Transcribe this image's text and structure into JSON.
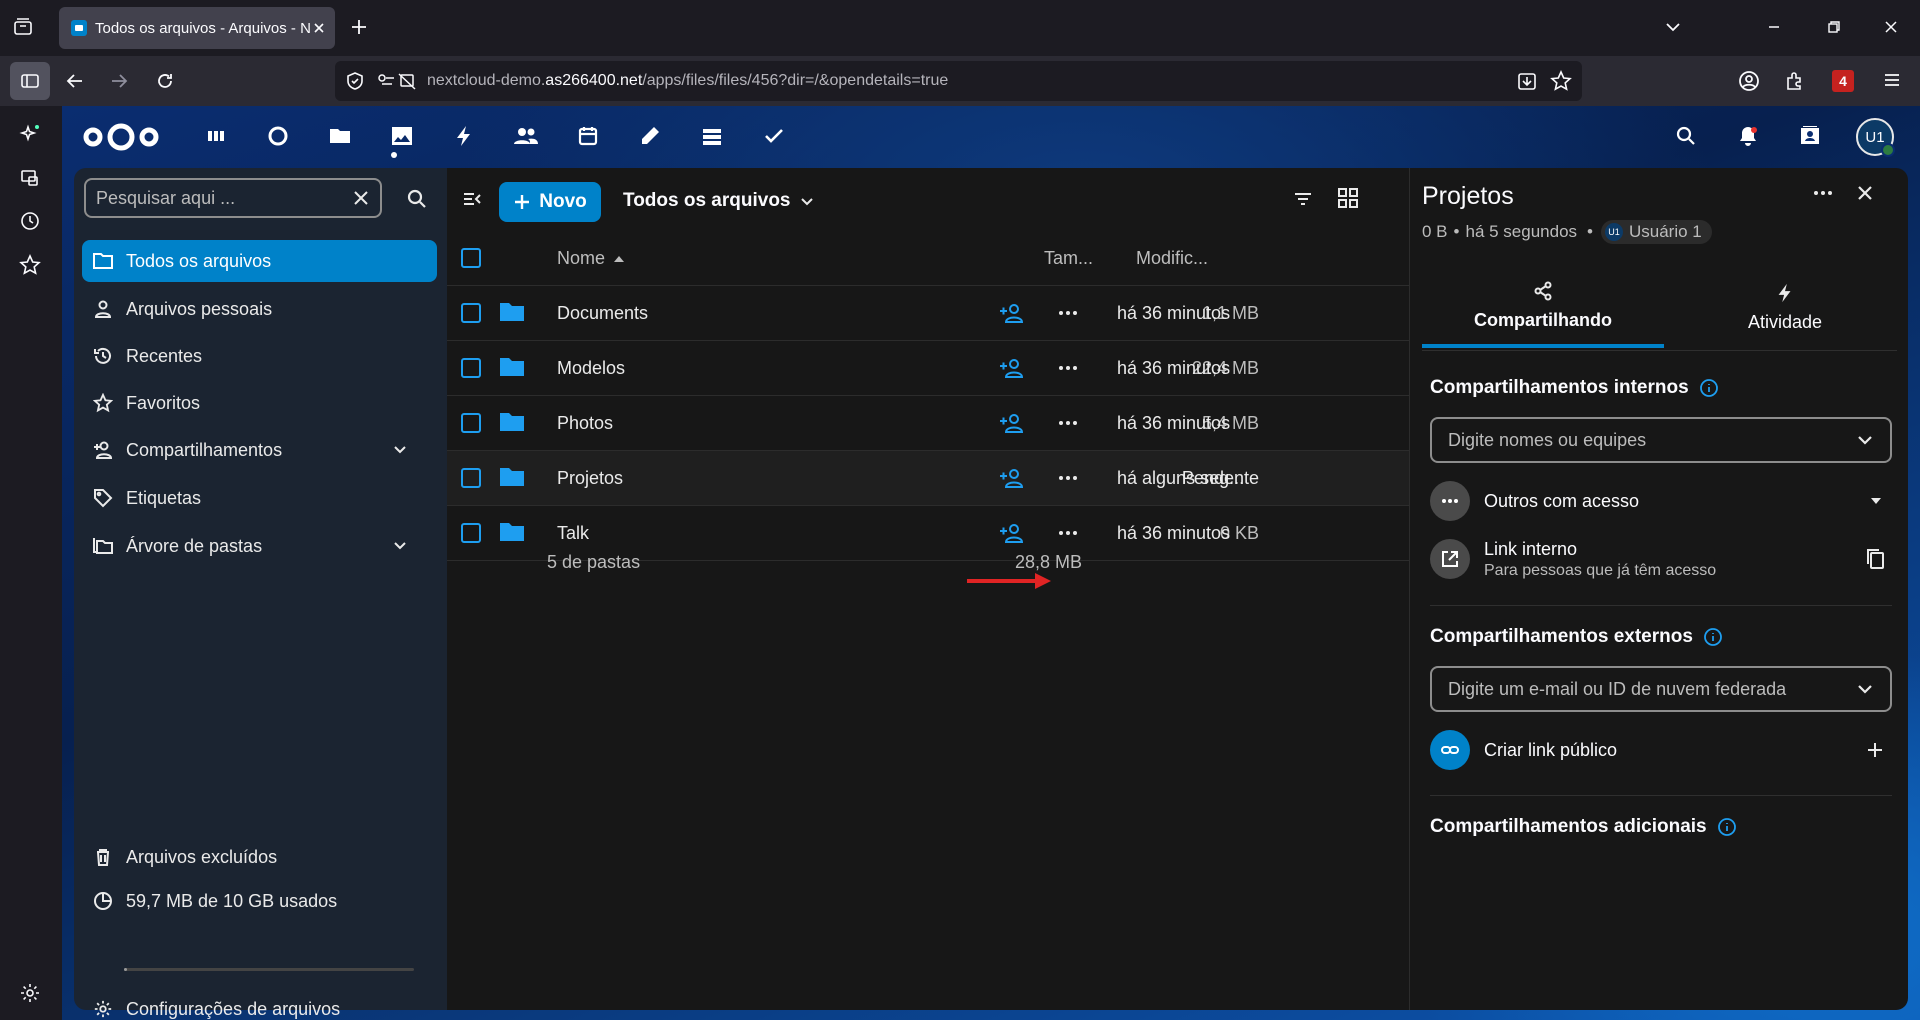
{
  "browser": {
    "tab_title": "Todos os arquivos - Arquivos - Nextcloud",
    "url_prefix": "nextcloud-demo.",
    "url_domain": "as266400.net",
    "url_path": "/apps/files/files/456?dir=/&opendetails=true",
    "extensions_badge": "4"
  },
  "header": {
    "apps": [
      "dashboard-icon",
      "talk-icon",
      "files-icon",
      "photos-icon",
      "activity-icon",
      "contacts-icon",
      "calendar-icon",
      "notes-icon",
      "deck-icon",
      "tasks-icon"
    ],
    "avatar_initials": "U1"
  },
  "sidebar": {
    "search_placeholder": "Pesquisar aqui ...",
    "items": [
      {
        "label": "Todos os arquivos",
        "icon": "folder-icon"
      },
      {
        "label": "Arquivos pessoais",
        "icon": "person-icon"
      },
      {
        "label": "Recentes",
        "icon": "history-icon"
      },
      {
        "label": "Favoritos",
        "icon": "star-icon"
      },
      {
        "label": "Compartilhamentos",
        "icon": "share-icon"
      },
      {
        "label": "Etiquetas",
        "icon": "tag-icon"
      },
      {
        "label": "Árvore de pastas",
        "icon": "folder-tree-icon"
      }
    ],
    "bottom": {
      "trash": "Arquivos excluídos",
      "quota": "59,7 MB de 10 GB usados",
      "quota_fraction": 0.006,
      "settings": "Configurações de arquivos"
    }
  },
  "main": {
    "new_button": "Novo",
    "breadcrumb": "Todos os arquivos",
    "columns": {
      "name": "Nome",
      "size": "Tam...",
      "modified": "Modific..."
    },
    "rows": [
      {
        "name": "Documents",
        "size": "1,1 MB",
        "modified": "há 36 minutos"
      },
      {
        "name": "Modelos",
        "size": "22,4 MB",
        "modified": "há 36 minutos"
      },
      {
        "name": "Photos",
        "size": "5,4 MB",
        "modified": "há 36 minutos"
      },
      {
        "name": "Projetos",
        "size": "Pendente",
        "modified": "há alguns seg..."
      },
      {
        "name": "Talk",
        "size": "0 KB",
        "modified": "há 36 minutos"
      }
    ],
    "summary": "5 de pastas",
    "summary_size": "28,8 MB"
  },
  "details": {
    "title": "Projetos",
    "size": "0 B",
    "time": "há 5 segundos",
    "owner_initials": "U1",
    "owner": "Usuário 1",
    "tabs": [
      "Compartilhando",
      "Atividade"
    ],
    "internal_title": "Compartilhamentos internos",
    "internal_placeholder": "Digite nomes ou equipes",
    "others_access": "Outros com acesso",
    "internal_link": "Link interno",
    "internal_link_sub": "Para pessoas que já têm acesso",
    "external_title": "Compartilhamentos externos",
    "external_placeholder": "Digite um e-mail ou ID de nuvem federada",
    "public_link": "Criar link público",
    "additional_title": "Compartilhamentos adicionais"
  },
  "colors": {
    "accent": "#0082c9",
    "arrow": "#e02424"
  }
}
